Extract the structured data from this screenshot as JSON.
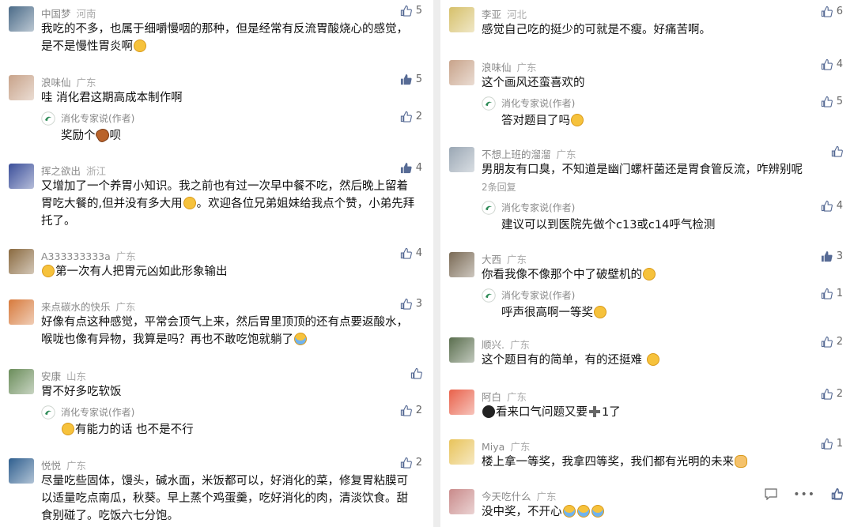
{
  "left": [
    {
      "user": "中国梦",
      "loc": "河南",
      "likes": "5",
      "liked": false,
      "text": [
        "我吃的不多，也属于细嚼慢咽的那种，但是经常有反流胃酸烧心的感觉，",
        "是不是慢性胃炎啊"
      ],
      "av": "#4b6b88"
    },
    {
      "user": "浪味仙",
      "loc": "广东",
      "likes": "5",
      "liked": true,
      "text": [
        "哇 消化君这期高成本制作啊"
      ],
      "av": "#c8a38a",
      "reply": {
        "name": "消化专家说(作者)",
        "likes": "2",
        "text": "奖励个",
        "emo": "drum",
        "tail": "呗"
      }
    },
    {
      "user": "挥之欲出",
      "loc": "浙江",
      "likes": "4",
      "liked": true,
      "text": [
        "又增加了一个养胃小知识。我之前也有过一次早中餐不吃，然后晚上留着",
        "胃吃大餐的,但并没有多大用",
        "。欢迎各位兄弟姐妹给我点个赞，小弟先拜",
        "托了。"
      ],
      "av": "#3b4f9a"
    },
    {
      "user": "A333333333a",
      "loc": "广东",
      "likes": "4",
      "liked": false,
      "text": [
        "第一次有人把胃元凶如此形象输出"
      ],
      "av": "#8a6a40"
    },
    {
      "user": "来点碳水的快乐",
      "loc": "广东",
      "likes": "3",
      "liked": false,
      "text": [
        "好像有点这种感觉，平常会顶气上来，然后胃里顶顶的还有点要返酸水，",
        "喉咙也像有异物，我算是吗？再也不敢吃饱就躺了"
      ],
      "av": "#d77a3c"
    },
    {
      "user": "安康",
      "loc": "山东",
      "likes": "",
      "liked": false,
      "text": [
        "胃不好多吃软饭"
      ],
      "av": "#6b8d5b",
      "reply": {
        "name": "消化专家说(作者)",
        "likes": "2",
        "text": "有能力的话 也不是不行",
        "emo": "",
        "tail": ""
      }
    },
    {
      "user": "悦悦",
      "loc": "广东",
      "likes": "2",
      "liked": false,
      "text": [
        "尽量吃些固体，馒头，碱水面，米饭都可以，好消化的菜，修复胃粘膜可",
        "以适量吃点南瓜，秋葵。早上蒸个鸡蛋羹，吃好消化的肉，清淡饮食。甜",
        "食别碰了。吃饭六七分饱。"
      ],
      "av": "#2f5f8f"
    }
  ],
  "right": [
    {
      "user": "李亚",
      "loc": "河北",
      "likes": "6",
      "liked": false,
      "text": [
        "感觉自己吃的挺少的可就是不瘦。好痛苦啊。"
      ],
      "av": "#d6c06a"
    },
    {
      "user": "浪味仙",
      "loc": "广东",
      "likes": "4",
      "liked": false,
      "text": [
        "这个画风还蛮喜欢的"
      ],
      "av": "#c8a38a",
      "reply": {
        "name": "消化专家说(作者)",
        "likes": "5",
        "text": "答对题目了吗",
        "emo": "",
        "tail": ""
      }
    },
    {
      "user": "不想上班的溜溜",
      "loc": "广东",
      "likes": "",
      "liked": false,
      "text": [
        "男朋友有口臭，不知道是幽门螺杆菌还是胃食管反流，咋辨别呢"
      ],
      "av": "#9aa7b4",
      "more": "2条回复",
      "reply": {
        "name": "消化专家说(作者)",
        "likes": "4",
        "text": "建议可以到医院先做个c13或c14呼气检测",
        "emo": "",
        "tail": ""
      }
    },
    {
      "user": "大西",
      "loc": "广东",
      "likes": "3",
      "liked": true,
      "text": [
        "你看我像不像那个中了破壁机的"
      ],
      "av": "#7a6a55",
      "reply": {
        "name": "消化专家说(作者)",
        "likes": "1",
        "text": "呼声很高啊一等奖",
        "emo": "",
        "tail": ""
      }
    },
    {
      "user": "顺兴.",
      "loc": "广东",
      "likes": "2",
      "liked": false,
      "text": [
        "这个题目有的简单，有的还挺难 "
      ],
      "av": "#5a6e4e"
    },
    {
      "user": "阿白",
      "loc": "广东",
      "likes": "2",
      "liked": false,
      "text": [
        "看来口气问题又要",
        "1了"
      ],
      "av": "#e9614a"
    },
    {
      "user": "Miya",
      "loc": "广东",
      "likes": "1",
      "liked": false,
      "text": [
        "楼上拿一等奖，我拿四等奖，我们都有光明的未来"
      ],
      "av": "#e8c35a"
    },
    {
      "user": "今天吃什么",
      "loc": "广东",
      "likes": "",
      "liked": false,
      "text": [
        "没中奖，不开心"
      ],
      "av": "#c98a8a"
    }
  ]
}
